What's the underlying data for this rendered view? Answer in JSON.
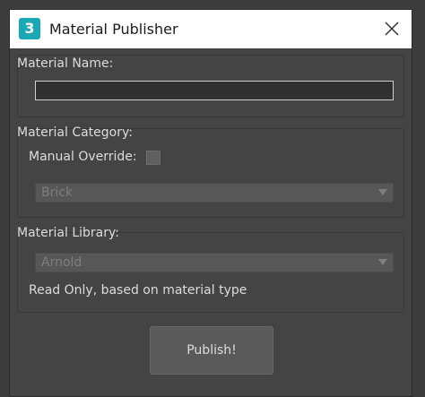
{
  "window": {
    "title": "Material Publisher",
    "app_icon_glyph": "3",
    "app_icon_name": "3dsmax-icon",
    "close_icon": "close-icon"
  },
  "material_name": {
    "label": "Material Name:",
    "value": ""
  },
  "material_category": {
    "label": "Material Category:",
    "manual_override_label": "Manual Override:",
    "manual_override_checked": false,
    "selected": "Brick"
  },
  "material_library": {
    "label": "Material Library:",
    "selected": "Arnold",
    "note": "Read Only, based on material type"
  },
  "actions": {
    "publish_label": "Publish!"
  },
  "colors": {
    "background": "#444444",
    "titlebar": "#ffffff",
    "icon_accent": "#1ba7b5",
    "text": "#dcdcdc",
    "disabled_text": "#7e7e7e"
  }
}
